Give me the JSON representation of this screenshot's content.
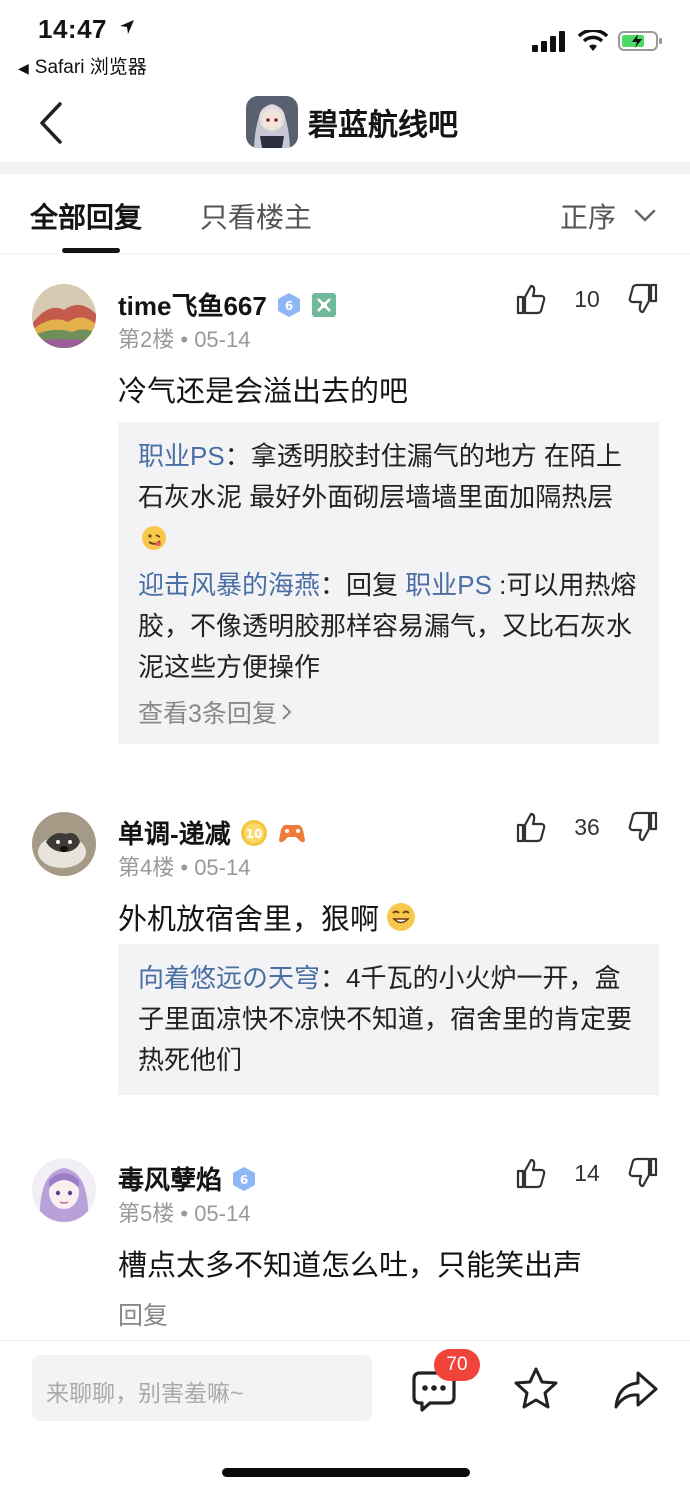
{
  "status_bar": {
    "time": "14:47",
    "back_app": "Safari 浏览器"
  },
  "nav": {
    "title": "碧蓝航线吧"
  },
  "tabs": {
    "all": "全部回复",
    "owner_only": "只看楼主",
    "sort": "正序"
  },
  "posts": [
    {
      "username": "time飞鱼667",
      "level_badge": "6",
      "floor": "第2楼",
      "date": "05-14",
      "likes": "10",
      "content": "冷气还是会溢出去的吧",
      "replies": [
        {
          "name": "职业PS",
          "sep": "：",
          "text": "拿透明胶封住漏气的地方 在陌上石灰水泥 最好外面砌层墙墙里面加隔热层"
        },
        {
          "name": "迎击风暴的海燕",
          "sep": "：",
          "prefix": "回复 ",
          "mention": "职业PS",
          "text": " :可以用热熔胶，不像透明胶那样容易漏气，又比石灰水泥这些方便操作"
        }
      ],
      "more_replies": "查看3条回复"
    },
    {
      "username": "单调-递减",
      "level_badge": "10",
      "floor": "第4楼",
      "date": "05-14",
      "likes": "36",
      "content": "外机放宿舍里，狠啊",
      "replies": [
        {
          "name": "向着悠远の天穹",
          "sep": "：",
          "text": "4千瓦的小火炉一开，盒子里面凉快不凉快不知道，宿舍里的肯定要热死他们"
        }
      ]
    },
    {
      "username": "毒风孽焰",
      "level_badge": "6",
      "floor": "第5楼",
      "date": "05-14",
      "likes": "14",
      "content": "槽点太多不知道怎么吐，只能笑出声",
      "reply_label": "回复"
    }
  ],
  "bottom": {
    "input_placeholder": "来聊聊，别害羞嘛~",
    "message_count": "70"
  },
  "colors": {
    "link": "#4a6fa5",
    "badge": "#f0443b",
    "quote_bg": "#f3f3f5"
  }
}
